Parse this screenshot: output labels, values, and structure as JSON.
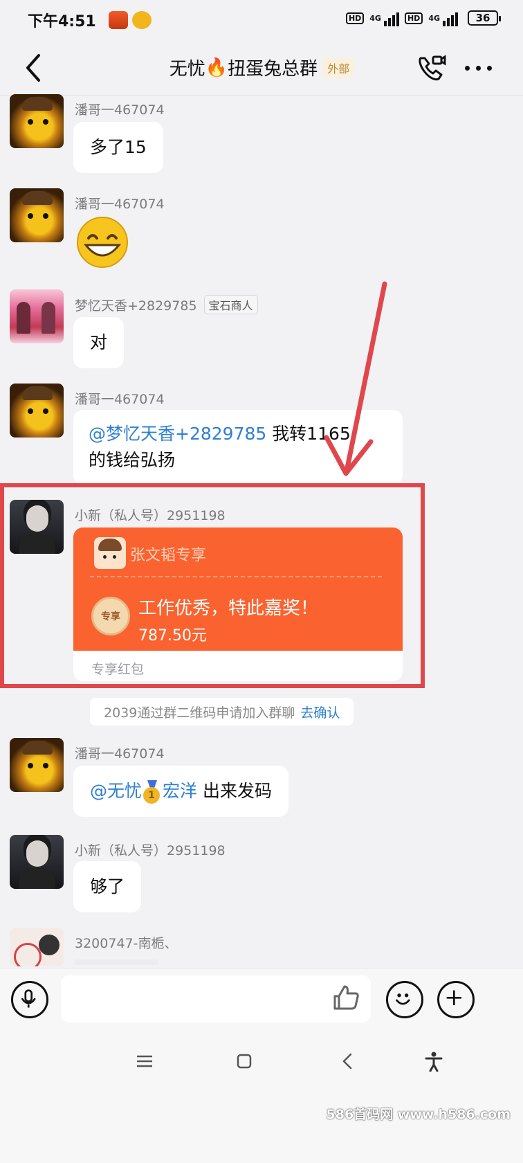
{
  "status_bar": {
    "time": "下午4:51",
    "battery": "36",
    "network_1": "4G",
    "network_2": "4G",
    "hd_label": "HD"
  },
  "header": {
    "title_prefix": "无忧",
    "title_emoji": "🔥",
    "title_suffix": "扭蛋兔总群",
    "tag": "外部",
    "icons": [
      "back-arrow-icon",
      "video-call-icon",
      "more-icon"
    ]
  },
  "messages": [
    {
      "sender": "潘哥一467074",
      "text": "多了15"
    },
    {
      "sender": "潘哥一467074",
      "emoji": "grinning-face"
    },
    {
      "sender": "梦忆天香+2829785",
      "badge": "宝石商人",
      "text": "对"
    },
    {
      "sender": "潘哥一467074",
      "mention": "@梦忆天香+2829785",
      "text_line1": " 我转1165",
      "text_line2": "的钱给弘扬"
    },
    {
      "sender": "小新（私人号）2951198"
    },
    {
      "sender": "潘哥一467074",
      "mention_a": "@无忧",
      "mention_b": "宏洋",
      "text": " 出来发码"
    },
    {
      "sender": "小新（私人号）2951198",
      "text": "够了"
    },
    {
      "sender": "3200747-南栀、"
    }
  ],
  "red_packet": {
    "owner": "张文韬专享",
    "medal_label": "专享",
    "wish": "工作优秀，特此嘉奖！",
    "amount": "787.50元",
    "type": "专享红包"
  },
  "system_message": {
    "text": "2039通过群二维码申请加入群聊",
    "link": "去确认"
  },
  "input_bar": {
    "placeholder": "",
    "icons": [
      "microphone-icon",
      "thumbs-up-icon",
      "emoji-icon",
      "plus-icon"
    ]
  },
  "watermark": "586首码网 www.h586.com",
  "colors": {
    "red_packet": "#fa6330",
    "mention": "#2f7fd1",
    "highlight": "#e0474d"
  }
}
